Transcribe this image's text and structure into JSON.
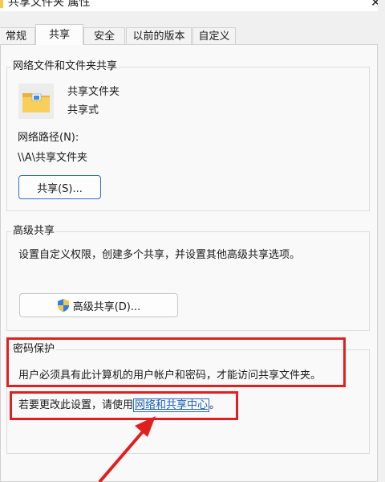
{
  "window": {
    "title": "共享文件夹 属性",
    "close_glyph": "✕"
  },
  "tabs": [
    {
      "label": "常规"
    },
    {
      "label": "共享",
      "active": true
    },
    {
      "label": "安全"
    },
    {
      "label": "以前的版本"
    },
    {
      "label": "自定义"
    }
  ],
  "sharing": {
    "group_title": "网络文件和文件夹共享",
    "folder_name": "共享文件夹",
    "folder_status": "共享式",
    "network_path_label": "网络路径(N):",
    "network_path": "\\\\A\\共享文件夹",
    "share_button": "共享(S)..."
  },
  "advanced": {
    "group_title": "高级共享",
    "description": "设置自定义权限，创建多个共享，并设置其他高级共享选项。",
    "button": "高级共享(D)..."
  },
  "password": {
    "group_title": "密码保护",
    "description": "用户必须具有此计算机的用户帐户和密码，才能访问共享文件夹。",
    "change_prefix": "若要更改此设置，请使用",
    "link": "网络和共享中心",
    "change_suffix": "。"
  },
  "colors": {
    "annotation_red": "#e02020",
    "link_blue": "#1a5fb4",
    "folder_yellow": "#f2c94c"
  }
}
